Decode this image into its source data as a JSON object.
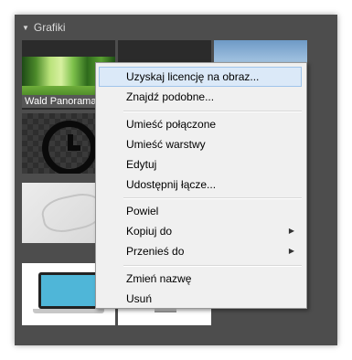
{
  "panel": {
    "title": "Grafiki",
    "collapse_icon": "triangle-down-icon"
  },
  "thumbnails": {
    "wald_label": "Wald Panorama"
  },
  "context_menu": {
    "items": [
      {
        "label": "Uzyskaj licencję na obraz...",
        "highlighted": true
      },
      {
        "label": "Znajdź podobne..."
      },
      {
        "label": "Umieść połączone"
      },
      {
        "label": "Umieść warstwy"
      },
      {
        "label": "Edytuj"
      },
      {
        "label": "Udostępnij łącze..."
      },
      {
        "label": "Powiel"
      },
      {
        "label": "Kopiuj  do",
        "submenu": true
      },
      {
        "label": "Przenieś  do",
        "submenu": true
      },
      {
        "label": "Zmień nazwę"
      },
      {
        "label": "Usuń"
      }
    ],
    "submenu_icon": "chevron-right-icon",
    "highlight_color": "#dbe9f8"
  }
}
